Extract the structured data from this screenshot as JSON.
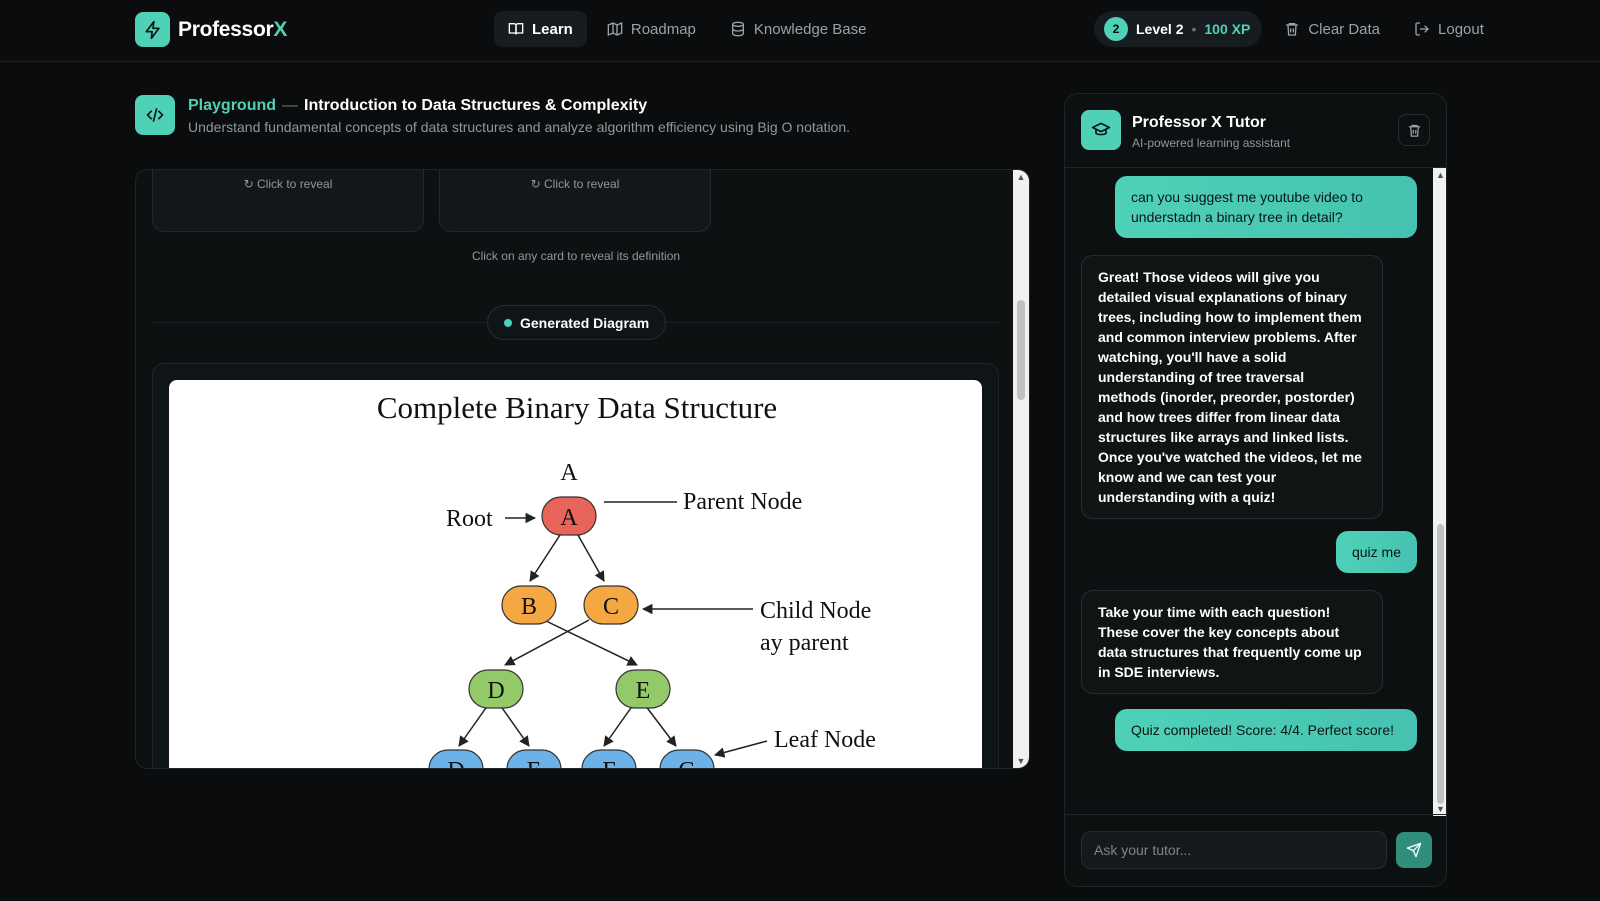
{
  "app": {
    "brand_main": "Professor",
    "brand_accent": "X"
  },
  "nav": [
    {
      "label": "Learn",
      "icon": "book-open-icon",
      "active": true
    },
    {
      "label": "Roadmap",
      "icon": "map-icon",
      "active": false
    },
    {
      "label": "Knowledge Base",
      "icon": "database-icon",
      "active": false
    }
  ],
  "status": {
    "level_num": "2",
    "level_label": "Level 2",
    "separator": "•",
    "xp": "100 XP"
  },
  "actions": {
    "clear": "Clear Data",
    "logout": "Logout"
  },
  "playground": {
    "label": "Playground",
    "dash": "—",
    "topic": "Introduction to Data Structures & Complexity",
    "description": "Understand fundamental concepts of data structures and analyze algorithm efficiency using Big O notation."
  },
  "cards": {
    "reveal": "Click to reveal",
    "hint": "Click on any card to reveal its definition"
  },
  "diagram": {
    "pill": "Generated Diagram",
    "title": "Complete Binary Data Structure",
    "top_label": "A",
    "root_label": "Root",
    "parent_label": "Parent Node",
    "child_label_1": "Child Node",
    "child_label_2": "ay parent",
    "leaf_label": "Leaf Node",
    "nodes": {
      "a": "A",
      "b": "B",
      "c": "C",
      "d": "D",
      "e": "E",
      "l1": "D",
      "l2": "E",
      "l3": "F",
      "l4": "G"
    },
    "colors": {
      "red": "#e8635a",
      "orange": "#f5a742",
      "green": "#94c96a",
      "blue": "#6cb2e8"
    }
  },
  "tutor": {
    "name": "Professor X Tutor",
    "subtitle": "AI-powered learning assistant",
    "placeholder": "Ask your tutor...",
    "messages": [
      {
        "role": "user",
        "text": "can you suggest me youtube video to understadn a binary tree in detail?"
      },
      {
        "role": "bot",
        "text": "Great! Those videos will give you detailed visual explanations of binary trees, including how to implement them and common interview problems. After watching, you'll have a solid understanding of tree traversal methods (inorder, preorder, postorder) and how trees differ from linear data structures like arrays and linked lists. Once you've watched the videos, let me know and we can test your understanding with a quiz!"
      },
      {
        "role": "user",
        "text": "quiz me"
      },
      {
        "role": "bot",
        "text": "Take your time with each question! These cover the key concepts about data structures that frequently come up in SDE interviews."
      },
      {
        "role": "user",
        "text": "Quiz completed! Score: 4/4. Perfect score!"
      }
    ]
  },
  "theme": {
    "accent": "#4fd1b8",
    "background": "#0a0c0d"
  }
}
